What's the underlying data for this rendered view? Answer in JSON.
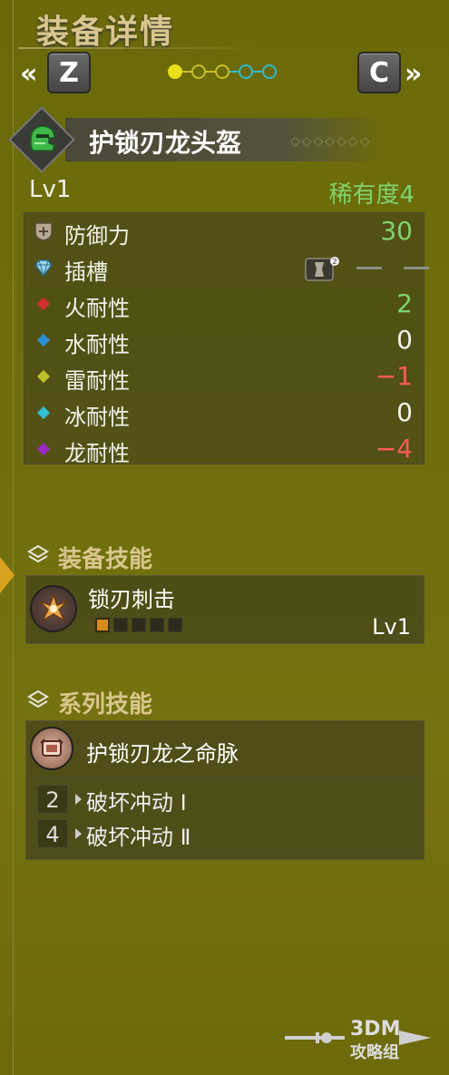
{
  "header": {
    "title": "装备详情",
    "prev_key": "Z",
    "next_key": "C",
    "prev_arrow": "«",
    "next_arrow": "»"
  },
  "page_dots": [
    {
      "color": "#e8de1c",
      "filled": true
    },
    {
      "color": "#c9bd2a",
      "filled": false
    },
    {
      "color": "#c9bd2a",
      "filled": false
    },
    {
      "color": "#33b9c9",
      "filled": false
    },
    {
      "color": "#33b9c9",
      "filled": false
    }
  ],
  "item": {
    "name": "护锁刃龙头盔",
    "level": "Lv1",
    "rarity": "稀有度4",
    "icon": "helmet-icon"
  },
  "stats": {
    "defense": {
      "label": "防御力",
      "value": "30",
      "color": "#7fd46e"
    },
    "slots": {
      "label": "插槽",
      "slot1": "—",
      "slot2": "—"
    },
    "fire": {
      "label": "火耐性",
      "value": "2",
      "color": "#7fd46e",
      "dot": "#d23030"
    },
    "water": {
      "label": "水耐性",
      "value": "0",
      "color": "#f2f2ea",
      "dot": "#2a8fd0"
    },
    "thunder": {
      "label": "雷耐性",
      "value": "−1",
      "color": "#ff5a5a",
      "dot": "#c0c02a"
    },
    "ice": {
      "label": "冰耐性",
      "value": "0",
      "color": "#f2f2ea",
      "dot": "#33c0d0"
    },
    "dragon": {
      "label": "龙耐性",
      "value": "−4",
      "color": "#ff5a5a",
      "dot": "#9a2ac0"
    }
  },
  "equip_skills": {
    "title": "装备技能",
    "skill": {
      "name": "锁刃刺击",
      "level": "Lv1",
      "filled": 1,
      "total": 5
    }
  },
  "series_skills": {
    "title": "系列技能",
    "name": "护锁刃龙之命脉",
    "tiers": [
      {
        "count": "2",
        "name": "破坏冲动 Ⅰ"
      },
      {
        "count": "4",
        "name": "破坏冲动 Ⅱ"
      }
    ]
  },
  "watermark": {
    "line1": "3DM",
    "line2": "攻略组"
  }
}
